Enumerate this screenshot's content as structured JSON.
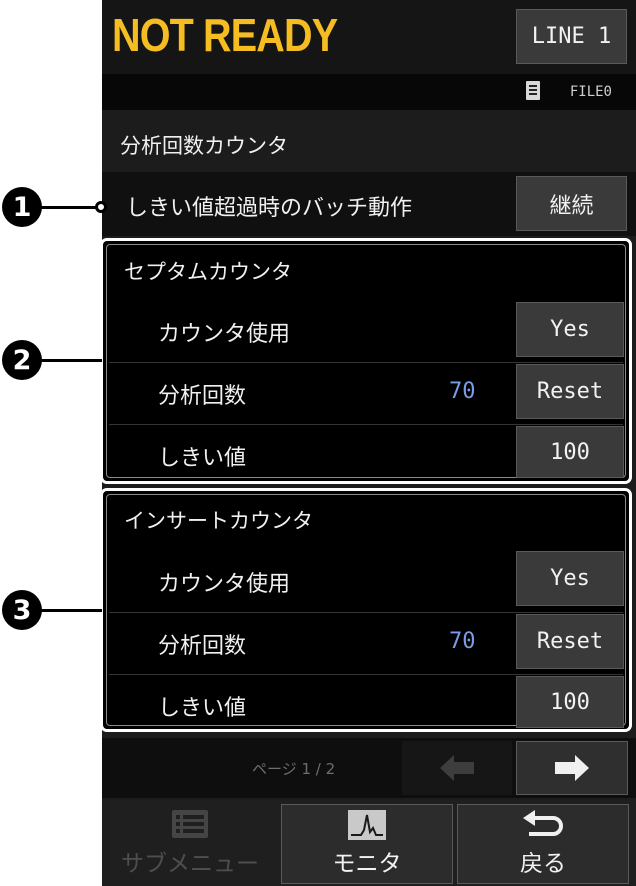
{
  "header": {
    "status": "NOT READY",
    "line_button": "LINE 1",
    "file_label": "FILE0"
  },
  "section": {
    "title": "分析回数カウンタ"
  },
  "threshold_row": {
    "label": "しきい値超過時のバッチ動作",
    "value": "継続"
  },
  "septum": {
    "title": "セプタムカウンタ",
    "use_label": "カウンタ使用",
    "use_value": "Yes",
    "count_label": "分析回数",
    "count_value": "70",
    "reset_label": "Reset",
    "threshold_label": "しきい値",
    "threshold_value": "100"
  },
  "insert": {
    "title": "インサートカウンタ",
    "use_label": "カウンタ使用",
    "use_value": "Yes",
    "count_label": "分析回数",
    "count_value": "70",
    "reset_label": "Reset",
    "threshold_label": "しきい値",
    "threshold_value": "100"
  },
  "pager": {
    "text": "ページ 1 / 2"
  },
  "footer": {
    "submenu": "サブメニュー",
    "monitor": "モニタ",
    "back": "戻る"
  },
  "callouts": [
    "1",
    "2",
    "3"
  ],
  "colors": {
    "status": "#f5bd22",
    "count": "#7b9ce8",
    "background": "#1c1c1c"
  }
}
